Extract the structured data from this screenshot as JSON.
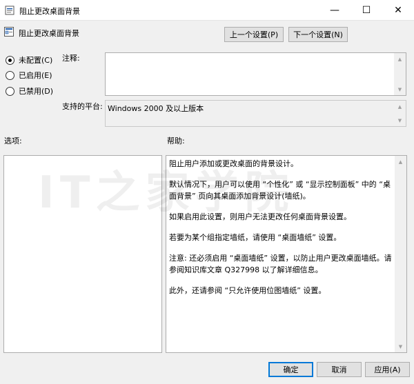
{
  "window": {
    "title": "阻止更改桌面背景",
    "minimize": "—",
    "maximize": "☐",
    "close": "✕"
  },
  "header": {
    "policy_name": "阻止更改桌面背景",
    "prev_button": "上一个设置(P)",
    "next_button": "下一个设置(N)"
  },
  "options": [
    {
      "label": "未配置(C)",
      "checked": true
    },
    {
      "label": "已启用(E)",
      "checked": false
    },
    {
      "label": "已禁用(D)",
      "checked": false
    }
  ],
  "comment": {
    "label": "注释:",
    "value": ""
  },
  "platform": {
    "label": "支持的平台:",
    "value": "Windows 2000 及以上版本"
  },
  "sections": {
    "options_label": "选项:",
    "help_label": "帮助:"
  },
  "help": [
    "阻止用户添加或更改桌面的背景设计。",
    "默认情况下，用户可以使用 “个性化” 或 “显示控制面板” 中的 “桌面背景” 页向其桌面添加背景设计(墙纸)。",
    "如果启用此设置，则用户无法更改任何桌面背景设置。",
    "若要为某个组指定墙纸，请使用 “桌面墙纸” 设置。",
    "注意: 还必须启用 “桌面墙纸” 设置，以防止用户更改桌面墙纸。请参阅知识库文章 Q327998 以了解详细信息。",
    "此外，还请参阅 “只允许使用位图墙纸” 设置。"
  ],
  "footer": {
    "ok": "确定",
    "cancel": "取消",
    "apply": "应用(A)"
  },
  "watermark": "IT之家学院"
}
